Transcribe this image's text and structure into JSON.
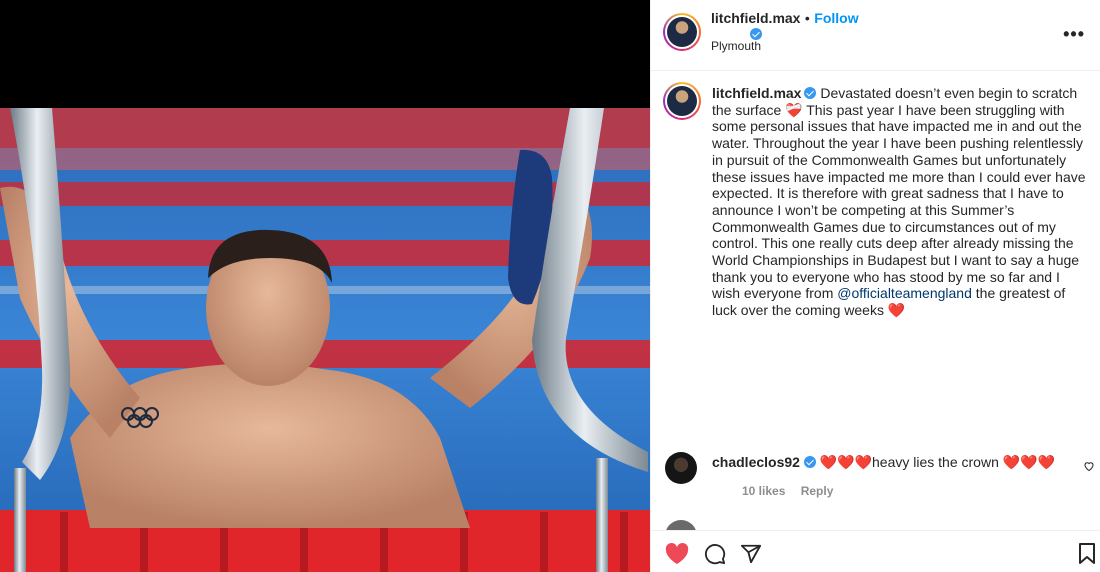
{
  "post": {
    "username": "litchfield.max",
    "follow_label": "Follow",
    "separator": "•",
    "location": "Plymouth",
    "more_label": "•••"
  },
  "caption": {
    "username": "litchfield.max",
    "text_1": "Devastated doesn’t even begin to scratch the surface ",
    "heart_1": "❤️‍🩹",
    "text_2": " This past year I have been struggling with some personal issues that have impacted me in and out the water. Throughout the year I have been pushing relentlessly in pursuit of the Commonwealth Games but unfortunately these issues have impacted me more than I could ever have expected. It is therefore with great sadness that I have to announce I won’t be competing at this Summer’s Commonwealth Games due to circumstances out of my control. This one really cuts deep after already missing the World Championships in Budapest but I want to say a huge thank you to everyone who has stood by me so far and I wish everyone from ",
    "mention": "@officialteamengland",
    "text_3": " the greatest of luck over the coming weeks ",
    "heart_2": "❤️"
  },
  "comments": [
    {
      "username": "chadleclos92",
      "hearts_before": "❤️❤️❤️",
      "text": "heavy lies the crown",
      "hearts_after": "❤️❤️❤️",
      "likes": "10 likes",
      "reply_label": "Reply"
    }
  ],
  "peek_comment": {
    "text": "..."
  },
  "colors": {
    "accent": "#0095f6",
    "mention": "#00376b",
    "like_red": "#ed4956",
    "verified": "#3897f0",
    "lane_red": "#d8232a",
    "pool_blue": "#2f74c4"
  },
  "icons": [
    "heart-icon",
    "comment-icon",
    "share-icon",
    "save-icon",
    "verified-icon",
    "more-icon"
  ]
}
